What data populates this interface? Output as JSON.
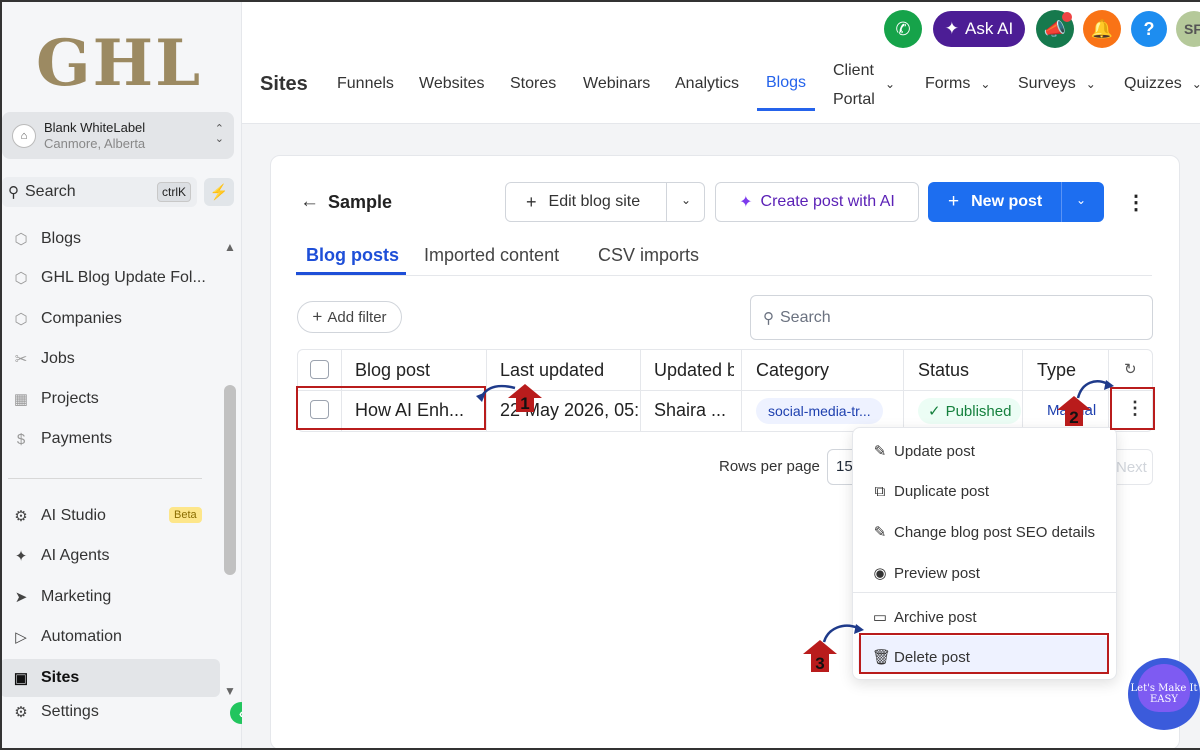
{
  "brand": {
    "logo": "GHL"
  },
  "account": {
    "name": "Blank WhiteLabel",
    "location": "Canmore, Alberta"
  },
  "sidebar": {
    "search_label": "Search",
    "search_shortcut": "ctrlK",
    "items": [
      {
        "label": "Blogs",
        "icon": "cube-icon"
      },
      {
        "label": "GHL Blog Update Fol...",
        "icon": "cube-icon"
      },
      {
        "label": "Companies",
        "icon": "cube-icon"
      },
      {
        "label": "Jobs",
        "icon": "tools-icon"
      },
      {
        "label": "Projects",
        "icon": "chart-icon"
      },
      {
        "label": "Payments",
        "icon": "dollar-icon"
      }
    ],
    "tools": [
      {
        "label": "AI Studio",
        "badge": "Beta"
      },
      {
        "label": "AI Agents"
      },
      {
        "label": "Marketing"
      },
      {
        "label": "Automation"
      },
      {
        "label": "Sites"
      },
      {
        "label": "Settings"
      }
    ]
  },
  "header": {
    "ask_ai": "Ask AI",
    "help": "?",
    "user_initials": "SF",
    "section_title": "Sites",
    "tabs": [
      "Funnels",
      "Websites",
      "Stores",
      "Webinars",
      "Analytics",
      "Blogs",
      "Client",
      "Portal",
      "Forms",
      "Surveys",
      "Quizzes"
    ],
    "active_tab": "Blogs"
  },
  "page": {
    "title": "Sample",
    "edit_site": "Edit blog site",
    "create_ai": "Create post with AI",
    "new_post": "New post",
    "subtabs": [
      "Blog posts",
      "Imported content",
      "CSV imports"
    ],
    "add_filter": "Add filter",
    "search_placeholder": "Search"
  },
  "table": {
    "columns": [
      "Blog post",
      "Last updated",
      "Updated by",
      "Category",
      "Status",
      "Type"
    ],
    "rows": [
      {
        "post": "How AI Enh...",
        "updated": "22 May 2026, 05:...",
        "by": "Shaira ...",
        "category": "social-media-tr...",
        "status": "Published",
        "type": "Manual"
      }
    ],
    "rows_per_page_label": "Rows per page",
    "rows_per_page": "15",
    "next": "Next"
  },
  "menu": {
    "items": [
      "Update post",
      "Duplicate post",
      "Change blog post SEO details",
      "Preview post",
      "Archive post",
      "Delete post"
    ]
  },
  "annotations": {
    "steps": [
      "1",
      "2",
      "3"
    ],
    "watermark": "Let's Make It EASY"
  },
  "colors": {
    "accent": "#1d6ef0",
    "annotation": "#b91c1c",
    "ask_ai": "#4c1d95",
    "success": "#15803d"
  }
}
